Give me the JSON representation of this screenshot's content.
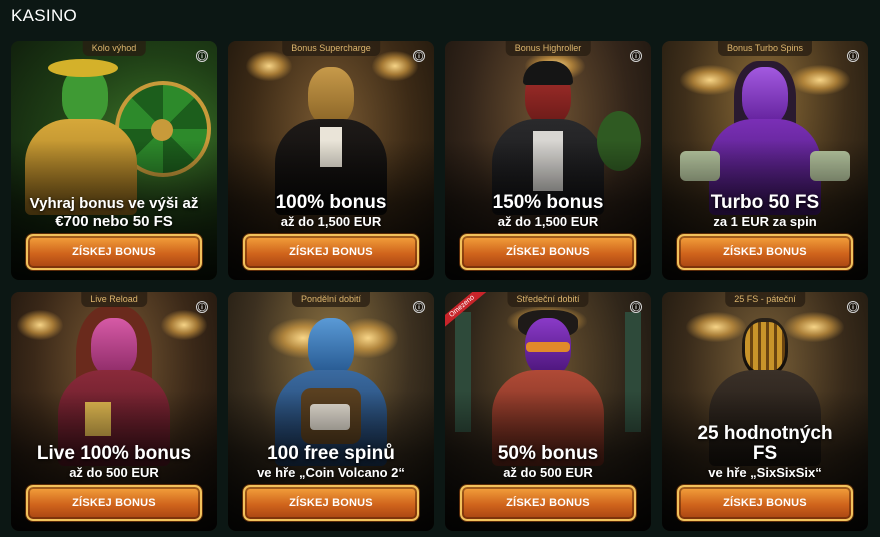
{
  "section": {
    "title": "KASINO"
  },
  "cards": [
    {
      "tag": "Kolo výhod",
      "headline": "Vyhraj bonus ve výši až",
      "subline": "€700 nebo 50 FS",
      "cta": "ZÍSKEJ BONUS",
      "info_icon": "ⓘ",
      "accent": "#2f6b24",
      "figure": "character-green-suit"
    },
    {
      "tag": "Bonus Supercharge",
      "headline": "100% bonus",
      "subline": "až do 1,500 EUR",
      "cta": "ZÍSKEJ BONUS",
      "info_icon": "ⓘ",
      "accent": "#6b4a26",
      "figure": "character-golden-tuxedo"
    },
    {
      "tag": "Bonus Highroller",
      "headline": "150% bonus",
      "subline": "až do 1,500 EUR",
      "cta": "ZÍSKEJ BONUS",
      "info_icon": "ⓘ",
      "accent": "#5c3d22",
      "figure": "character-red-beanie"
    },
    {
      "tag": "Bonus Turbo Spins",
      "headline": "Turbo 50 FS",
      "subline": "za 1 EUR za spin",
      "cta": "ZÍSKEJ BONUS",
      "info_icon": "ⓘ",
      "accent": "#6e5426",
      "figure": "character-purple-woman"
    },
    {
      "tag": "Live Reload",
      "headline": "Live 100% bonus",
      "subline": "až do 500 EUR",
      "cta": "ZÍSKEJ BONUS",
      "info_icon": "ⓘ",
      "accent": "#6a4626",
      "figure": "character-pink-woman"
    },
    {
      "tag": "Pondělní dobití",
      "headline": "100 free spinů",
      "subline": "ve hře „Coin Volcano 2“",
      "cta": "ZÍSKEJ BONUS",
      "info_icon": "ⓘ",
      "accent": "#5e4a2c",
      "figure": "character-blue-crystal"
    },
    {
      "tag": "Středeční dobití",
      "ribbon": "Omezeno",
      "headline": "50% bonus",
      "subline": "až do 500 EUR",
      "cta": "ZÍSKEJ BONUS",
      "info_icon": "ⓘ",
      "accent": "#4a3a26",
      "figure": "character-purple-sunglasses"
    },
    {
      "tag": "25 FS - páteční",
      "headline": "25 hodnotných FS",
      "subline": "ve hře „SixSixSix“",
      "cta": "ZÍSKEJ BONUS",
      "info_icon": "ⓘ",
      "accent": "#5a4628",
      "figure": "character-gold-mask"
    }
  ]
}
